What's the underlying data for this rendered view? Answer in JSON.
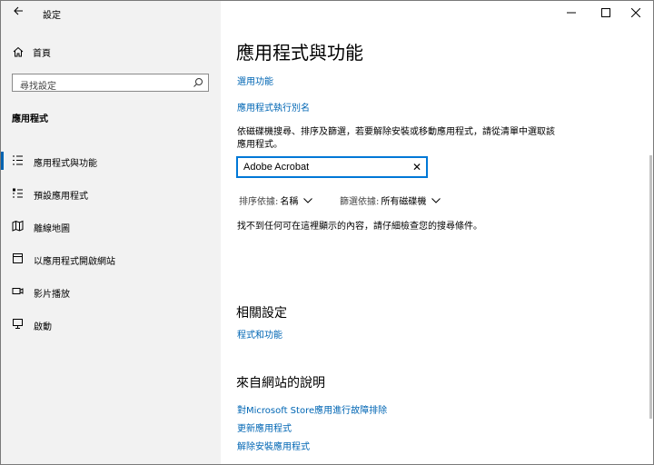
{
  "window": {
    "title": "設定"
  },
  "sidebar": {
    "home_label": "首頁",
    "search_placeholder": "尋找設定",
    "section_title": "應用程式",
    "items": [
      {
        "label": "應用程式與功能",
        "icon": "apps-list-icon",
        "active": true
      },
      {
        "label": "預設應用程式",
        "icon": "default-apps-icon"
      },
      {
        "label": "離線地圖",
        "icon": "map-icon"
      },
      {
        "label": "以應用程式開啟網站",
        "icon": "open-with-icon"
      },
      {
        "label": "影片播放",
        "icon": "video-icon"
      },
      {
        "label": "啟動",
        "icon": "startup-icon"
      }
    ]
  },
  "main": {
    "title": "應用程式與功能",
    "links": {
      "optional_features": "選用功能",
      "app_aliases": "應用程式執行別名"
    },
    "description": "依磁碟機搜尋、排序及篩選，若要解除安裝或移動應用程式，請從清單中選取該應用程式。",
    "filter": {
      "value": "Adobe Acrobat"
    },
    "sort": {
      "label": "排序依據:",
      "value": "名稱"
    },
    "filter_by": {
      "label": "篩選依據:",
      "value": "所有磁碟機"
    },
    "empty_message": "找不到任何可在這裡顯示的內容，請仔細檢查您的搜尋條件。",
    "related": {
      "heading": "相關設定",
      "link": "程式和功能"
    },
    "help": {
      "heading": "來自網站的說明",
      "links": [
        "對Microsoft Store應用進行故障排除",
        "更新應用程式",
        "解除安裝應用程式"
      ]
    }
  }
}
